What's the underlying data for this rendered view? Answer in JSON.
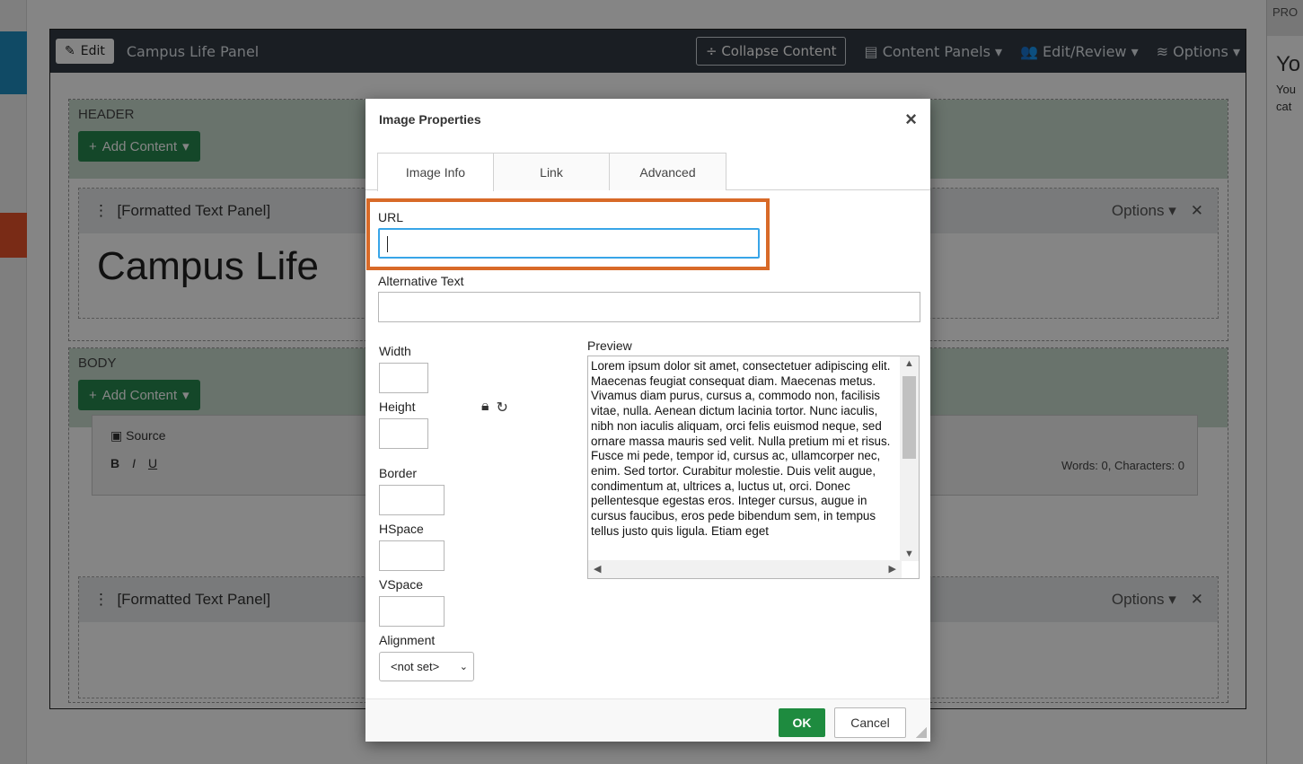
{
  "editor": {
    "edit_label": "Edit",
    "title": "Campus Life Panel",
    "collapse_label": "Collapse Content",
    "content_panels_label": "Content Panels",
    "edit_review_label": "Edit/Review",
    "options_label": "Options"
  },
  "regions": {
    "header_label": "HEADER",
    "body_label": "BODY",
    "add_content_label": "Add Content"
  },
  "panels": {
    "panel1_title": "[Formatted Text Panel]",
    "panel1_heading": "Campus Life",
    "panel2_title": "[Formatted Text Panel]",
    "options_label": "Options"
  },
  "cke": {
    "source_label": "Source",
    "wordcount": "Words: 0, Characters: 0"
  },
  "right_panel": {
    "header": "PRO",
    "big": "Yo",
    "line1": "You",
    "line2": "cat"
  },
  "dialog": {
    "title": "Image Properties",
    "tabs": [
      "Image Info",
      "Link",
      "Advanced"
    ],
    "url_label": "URL",
    "url_value": "",
    "alt_label": "Alternative Text",
    "alt_value": "",
    "width_label": "Width",
    "height_label": "Height",
    "border_label": "Border",
    "hspace_label": "HSpace",
    "vspace_label": "VSpace",
    "alignment_label": "Alignment",
    "alignment_value": "<not set>",
    "preview_label": "Preview",
    "preview_text": "Lorem ipsum dolor sit amet, consectetuer adipiscing elit. Maecenas feugiat consequat diam. Maecenas metus. Vivamus diam purus, cursus a, commodo non, facilisis vitae, nulla. Aenean dictum lacinia tortor. Nunc iaculis, nibh non iaculis aliquam, orci felis euismod neque, sed ornare massa mauris sed velit. Nulla pretium mi et risus. Fusce mi pede, tempor id, cursus ac, ullamcorper nec, enim. Sed tortor. Curabitur molestie. Duis velit augue, condimentum at, ultrices a, luctus ut, orci. Donec pellentesque egestas eros. Integer cursus, augue in cursus faucibus, eros pede bibendum sem, in tempus tellus justo quis ligula. Etiam eget",
    "ok_label": "OK",
    "cancel_label": "Cancel"
  }
}
